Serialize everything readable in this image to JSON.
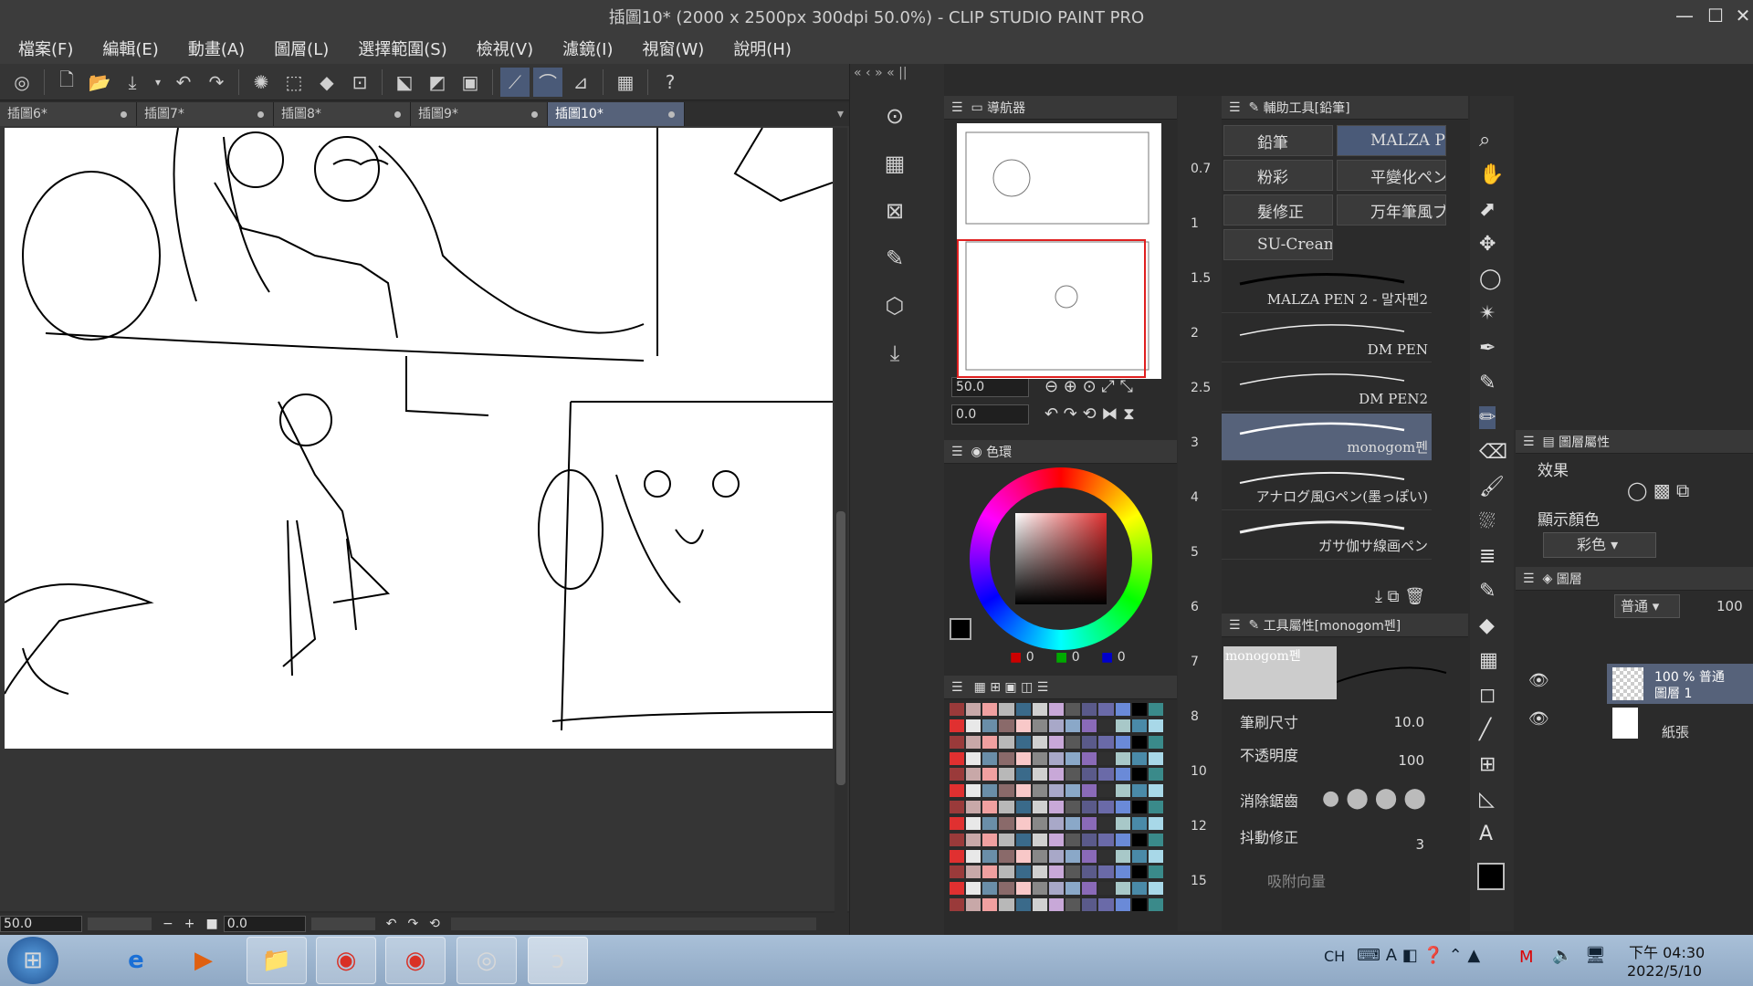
{
  "window": {
    "title": "插圖10* (2000 x 2500px 300dpi 50.0%)  - CLIP STUDIO PAINT PRO",
    "controls": [
      "—",
      "☐",
      "✕"
    ]
  },
  "menu": [
    "檔案(F)",
    "編輯(E)",
    "動畫(A)",
    "圖層(L)",
    "選擇範圍(S)",
    "檢視(V)",
    "濾鏡(I)",
    "視窗(W)",
    "說明(H)"
  ],
  "tabs": [
    {
      "label": "插圖6*"
    },
    {
      "label": "插圖7*"
    },
    {
      "label": "插圖8*"
    },
    {
      "label": "插圖9*"
    },
    {
      "label": "插圖10*"
    }
  ],
  "status": {
    "zoom": "50.0",
    "angle": "0.0"
  },
  "navigator": {
    "title": "導航器",
    "zoom": "50.0",
    "rotation": "0.0"
  },
  "color": {
    "title": "色環",
    "r": "0",
    "g": "0",
    "b": "0"
  },
  "ruler_ticks": [
    "0.7",
    "1",
    "1.5",
    "2",
    "2.5",
    "3",
    "4",
    "5",
    "6",
    "7",
    "8",
    "10",
    "12",
    "15"
  ],
  "subtool": {
    "title": "輔助工具[鉛筆]",
    "groups": [
      "鉛筆",
      "MALZA PEN",
      "粉彩",
      "平變化ペン",
      "髮修正",
      "万年筆風ブ",
      "SU-Cream"
    ],
    "brushes": [
      "MALZA PEN 2 - 말자펜2",
      "DM PEN",
      "DM PEN2",
      "monogom펜",
      "アナログ風Gペン(墨っぽい)",
      "ガサ伽サ線画ペン"
    ]
  },
  "toolprop": {
    "title": "工具屬性[monogom펜]",
    "brush_name": "monogom펜",
    "brush_size_label": "筆刷尺寸",
    "brush_size": "10.0",
    "opacity_label": "不透明度",
    "opacity": "100",
    "antialias_label": "消除鋸齒",
    "stabilization_label": "抖動修正",
    "stabilization": "3",
    "snap_label": "吸附向量"
  },
  "layerprop": {
    "title": "圖層屬性",
    "effect_label": "效果",
    "display_color_label": "顯示顏色",
    "display_color": "彩色"
  },
  "layers": {
    "title": "圖層",
    "blend_mode": "普通",
    "opacity": "100",
    "items": [
      {
        "line1": "100 % 普通",
        "line2": "圖層 1"
      },
      {
        "line1": "",
        "line2": "紙張"
      }
    ]
  },
  "taskbar": {
    "lang": "CH",
    "time": "下午 04:30",
    "date": "2022/5/10"
  },
  "colors": {
    "accent": "#56627a",
    "panel_bg": "#2b2b2b",
    "selection_red": "#e02020"
  }
}
